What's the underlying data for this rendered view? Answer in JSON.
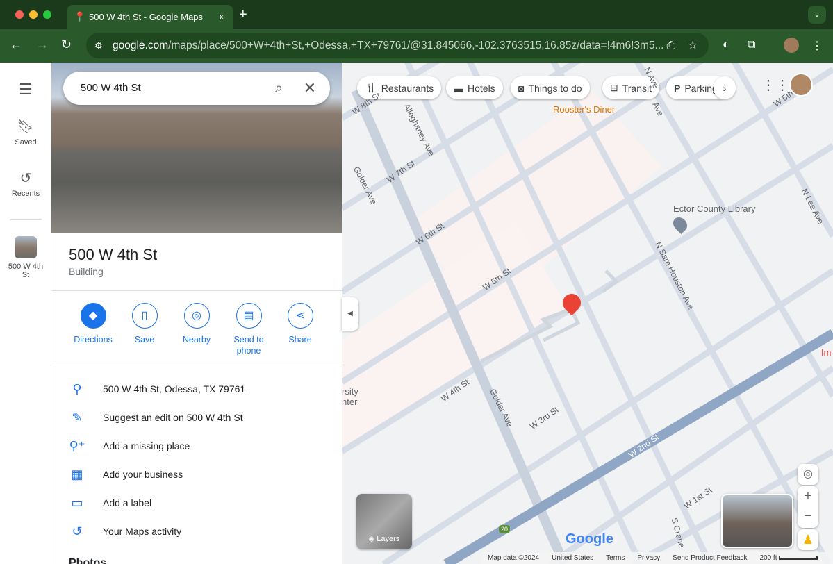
{
  "browser": {
    "tab_title": "500 W 4th St - Google Maps",
    "close": "x",
    "new_tab": "+",
    "tab_menu": "⌄",
    "url_host": "google.com",
    "url_path": "/maps/place/500+W+4th+St,+Odessa,+TX+79761/@31.845066,-102.3763515,16.85z/data=!4m6!3m5..."
  },
  "rail": {
    "menu_icon": "hamburger-icon",
    "items": [
      {
        "label": "Saved"
      },
      {
        "label": "Recents"
      },
      {
        "label": "500 W 4th St"
      }
    ]
  },
  "search": {
    "value": "500 W 4th St"
  },
  "place": {
    "title": "500 W 4th St",
    "category": "Building"
  },
  "actions": [
    {
      "label": "Directions"
    },
    {
      "label": "Save"
    },
    {
      "label": "Nearby"
    },
    {
      "label": "Send to phone"
    },
    {
      "label": "Share"
    }
  ],
  "details": [
    {
      "text": "500 W 4th St, Odessa, TX 79761"
    },
    {
      "text": "Suggest an edit on 500 W 4th St"
    },
    {
      "text": "Add a missing place"
    },
    {
      "text": "Add your business"
    },
    {
      "text": "Add a label"
    },
    {
      "text": "Your Maps activity"
    }
  ],
  "photos_heading": "Photos",
  "chips": [
    {
      "label": "Restaurants"
    },
    {
      "label": "Hotels"
    },
    {
      "label": "Things to do"
    },
    {
      "label": "Transit"
    },
    {
      "label": "Parking"
    }
  ],
  "map": {
    "pois": [
      {
        "name": "Rooster's Diner"
      },
      {
        "name": "Ector County Library"
      },
      {
        "name": "rsity\nnter"
      },
      {
        "name": "Im"
      }
    ],
    "streets": [
      "W 8th St",
      "Alleghaney Ave",
      "W 7th St",
      "Golder Ave",
      "W 6th St",
      "W 5th St",
      "N Sam Houston Ave",
      "W 4th St",
      "Golder Ave",
      "W 3rd St",
      "W 2nd St",
      "W 1st St",
      "S Crane",
      "N Lee Ave",
      "N Ave",
      "W 5th",
      "Ave",
      "20"
    ],
    "layers_label": "Layers",
    "footer": {
      "map_data": "Map data ©2024",
      "country": "United States",
      "terms": "Terms",
      "privacy": "Privacy",
      "feedback": "Send Product Feedback",
      "scale": "200 ft"
    },
    "logo": "Google",
    "accent": "#1a73e8",
    "pin": "#ea4335"
  }
}
